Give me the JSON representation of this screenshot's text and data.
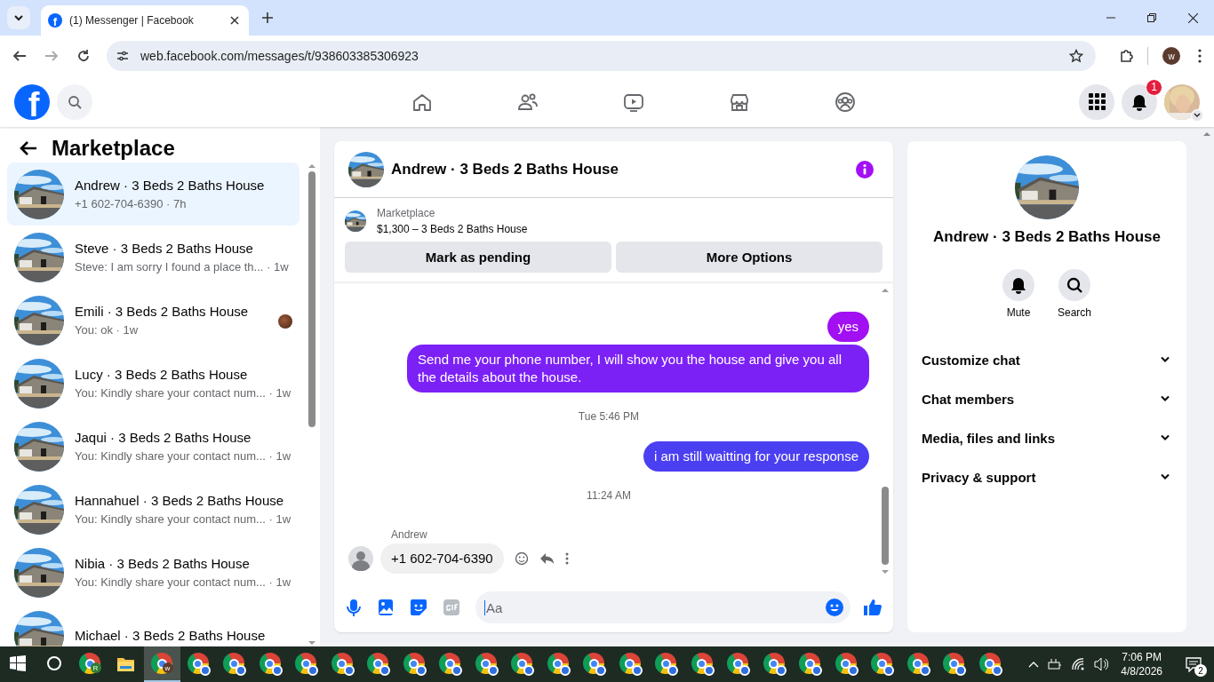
{
  "browser": {
    "tab": {
      "favicon": "f",
      "title": "(1) Messenger | Facebook"
    },
    "url": "web.facebook.com/messages/t/938603385306923",
    "profile": "w"
  },
  "header": {
    "logo": "f",
    "nav": [
      {
        "kind": "home",
        "selected": false
      },
      {
        "kind": "friends",
        "selected": false
      },
      {
        "kind": "watch",
        "selected": false
      },
      {
        "kind": "marketplace",
        "selected": false
      },
      {
        "kind": "groups",
        "selected": false
      }
    ],
    "notifications": "1"
  },
  "sidebar": {
    "title": "Marketplace",
    "conversations": [
      {
        "name": "Andrew · 3 Beds 2 Baths House",
        "meta": "+1 602-704-6390 · 7h",
        "selected": true,
        "read_receipt": false
      },
      {
        "name": "Steve · 3 Beds 2 Baths House",
        "meta": "Steve: I am sorry I found a place th... · 1w",
        "selected": false,
        "read_receipt": false
      },
      {
        "name": "Emili · 3 Beds 2 Baths House",
        "meta": "You: ok · 1w",
        "selected": false,
        "read_receipt": true
      },
      {
        "name": "Lucy · 3 Beds 2 Baths House",
        "meta": "You: Kindly share your contact num... · 1w",
        "selected": false,
        "read_receipt": false
      },
      {
        "name": "Jaqui · 3 Beds 2 Baths House",
        "meta": "You: Kindly share your contact num... · 1w",
        "selected": false,
        "read_receipt": false
      },
      {
        "name": "Hannahuel · 3 Beds 2 Baths House",
        "meta": "You: Kindly share your contact num... · 1w",
        "selected": false,
        "read_receipt": false
      },
      {
        "name": "Nibia · 3 Beds 2 Baths House",
        "meta": "You: Kindly share your contact num... · 1w",
        "selected": false,
        "read_receipt": false
      },
      {
        "name": "Michael · 3 Beds 2 Baths House",
        "selected": false,
        "read_receipt": false
      }
    ]
  },
  "chat": {
    "title": "Andrew · 3 Beds 2 Baths House",
    "listing": {
      "label": "Marketplace",
      "price": "$1,300 – 3 Beds 2 Baths House"
    },
    "actions": [
      "Mark as pending",
      "More Options"
    ],
    "messages": [
      {
        "kind": "outgoing",
        "text": "yes",
        "color": "#a10ff2"
      },
      {
        "kind": "outgoing",
        "text": "Send me your phone number, I will show you the house and give you all the details about the house.",
        "color": "#7c21f6"
      },
      {
        "kind": "timestamp",
        "text": "Tue 5:46 PM"
      },
      {
        "kind": "outgoing",
        "text": "i am still waitting for your response",
        "color": "#4b3ff2"
      },
      {
        "kind": "timestamp",
        "text": "11:24 AM"
      },
      {
        "kind": "incoming",
        "sender": "Andrew",
        "text": "+1 602-704-6390"
      }
    ],
    "composer": {
      "placeholder": "Aa"
    }
  },
  "details": {
    "title": "Andrew · 3 Beds 2 Baths House",
    "actions": [
      {
        "kind": "mute",
        "label": "Mute"
      },
      {
        "kind": "search",
        "label": "Search"
      }
    ],
    "sections": [
      {
        "label": "Customize chat",
        "expanded": false
      },
      {
        "label": "Chat members",
        "expanded": false
      },
      {
        "label": "Media, files and links",
        "expanded": false
      },
      {
        "label": "Privacy & support",
        "expanded": false
      }
    ]
  },
  "taskbar": {
    "apps": [
      {
        "kind": "start",
        "active": false
      },
      {
        "kind": "search",
        "active": false
      },
      {
        "kind": "chrome",
        "badge": "R",
        "active": false
      },
      {
        "kind": "explorer",
        "active": false
      },
      {
        "kind": "chrome",
        "badge": "w",
        "active": true
      },
      {
        "kind": "chrome-profile",
        "active": false
      },
      {
        "kind": "chrome-profile",
        "active": false
      },
      {
        "kind": "chrome-profile",
        "active": false
      },
      {
        "kind": "chrome-profile",
        "active": false
      },
      {
        "kind": "chrome-profile",
        "active": false
      },
      {
        "kind": "chrome-profile",
        "active": false
      },
      {
        "kind": "chrome-profile",
        "active": false
      },
      {
        "kind": "chrome-profile",
        "active": false
      },
      {
        "kind": "chrome-profile",
        "active": false
      },
      {
        "kind": "chrome-profile",
        "active": false
      },
      {
        "kind": "chrome-profile",
        "active": false
      },
      {
        "kind": "chrome-profile",
        "active": false
      },
      {
        "kind": "chrome-profile",
        "active": false
      },
      {
        "kind": "chrome-profile",
        "active": false
      },
      {
        "kind": "chrome-profile",
        "active": false
      },
      {
        "kind": "chrome-profile",
        "active": false
      },
      {
        "kind": "chrome-profile",
        "active": false
      },
      {
        "kind": "chrome-profile",
        "active": false
      },
      {
        "kind": "chrome-profile",
        "active": false
      },
      {
        "kind": "chrome-profile",
        "active": false
      },
      {
        "kind": "chrome-profile",
        "active": false
      },
      {
        "kind": "chrome-profile",
        "active": false
      },
      {
        "kind": "chrome-profile",
        "active": false
      }
    ],
    "time": "7:06 PM",
    "date": "4/8/2026",
    "notifications": "2"
  }
}
